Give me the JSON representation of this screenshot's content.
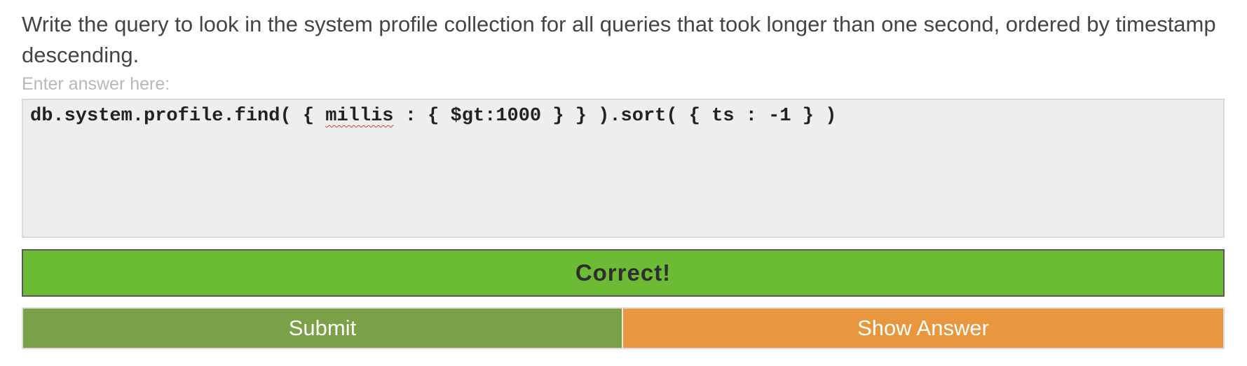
{
  "question": {
    "text": "Write the query to look in the system profile collection for all queries that took longer than one second, ordered by timestamp descending."
  },
  "answer": {
    "label": "Enter answer here:",
    "code_before": "db.system.profile.find( { ",
    "code_misspelled": "millis",
    "code_after": " : { $gt:1000 } } ).sort( { ts : -1 } )"
  },
  "result": {
    "text": "Correct!"
  },
  "buttons": {
    "submit_label": "Submit",
    "show_answer_label": "Show Answer"
  },
  "colors": {
    "result_bg": "#6cbb35",
    "submit_bg": "#7ba148",
    "show_answer_bg": "#e8973e",
    "code_bg": "#eeeeee"
  }
}
